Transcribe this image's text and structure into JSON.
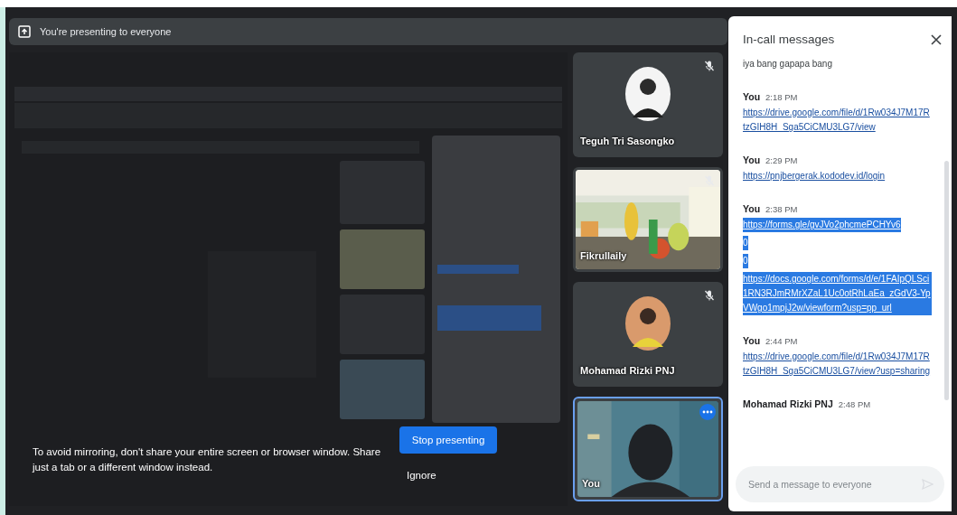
{
  "presenting_bar": {
    "text": "You're presenting to everyone"
  },
  "mirror_prompt": {
    "message": "To avoid mirroring, don't share your entire screen or browser window. Share just a tab or a different window instead.",
    "primary_button": "Stop presenting",
    "secondary_button": "Ignore"
  },
  "tiles": [
    {
      "name": "Teguh Tri Sasongko",
      "kind": "avatar",
      "muted": true,
      "selected": false
    },
    {
      "name": "Fikrullaily",
      "kind": "video",
      "muted": true,
      "selected": false
    },
    {
      "name": "Mohamad Rizki PNJ",
      "kind": "avatar",
      "muted": true,
      "selected": false
    },
    {
      "name": "You",
      "kind": "video",
      "muted": false,
      "selected": true
    }
  ],
  "chat": {
    "title": "In-call messages",
    "messages": [
      {
        "items": [
          {
            "kind": "text",
            "text": "iya bang gapapa bang",
            "selected": false
          }
        ]
      },
      {
        "sender": "You",
        "time": "2:18 PM",
        "items": [
          {
            "kind": "link",
            "text": "https://drive.google.com/file/d/1Rw034J7M17RtzGIH8H_Sga5CiCMU3LG7/view",
            "selected": false
          }
        ]
      },
      {
        "sender": "You",
        "time": "2:29 PM",
        "items": [
          {
            "kind": "link",
            "text": "https://pnjbergerak.kododev.id/login",
            "selected": false
          }
        ]
      },
      {
        "sender": "You",
        "time": "2:38 PM",
        "items": [
          {
            "kind": "link",
            "text": "https://forms.gle/gvJVo2phcmePCHYv6",
            "selected": true
          },
          {
            "kind": "text",
            "text": "0",
            "selected": true
          },
          {
            "kind": "text",
            "text": "0",
            "selected": true
          },
          {
            "kind": "link",
            "text": "https://docs.google.com/forms/d/e/1FAIpQLSci1RN3RJmRMrXZaL1Uc0otRhLaEa_zGdV3-YpVWgo1mpjJ2w/viewform?usp=pp_url",
            "selected": true
          }
        ]
      },
      {
        "sender": "You",
        "time": "2:44 PM",
        "items": [
          {
            "kind": "link",
            "text": "https://drive.google.com/file/d/1Rw034J7M17RtzGIH8H_Sga5CiCMU3LG7/view?usp=sharing",
            "selected": false
          }
        ]
      },
      {
        "sender": "Mohamad Rizki PNJ",
        "time": "2:48 PM"
      }
    ],
    "input": {
      "placeholder": "Send a message to everyone"
    }
  }
}
